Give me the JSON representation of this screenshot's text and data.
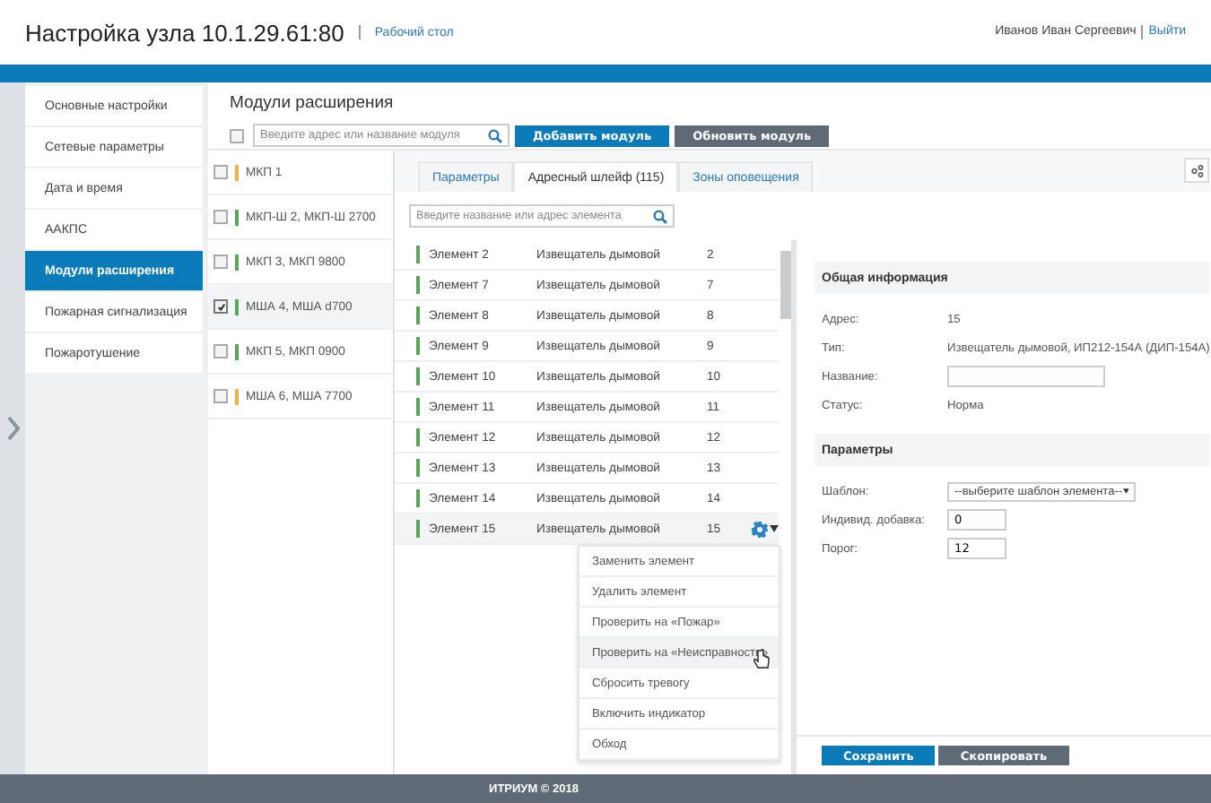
{
  "header": {
    "title": "Настройка узла 10.1.29.61:80",
    "link": "Рабочий стол",
    "user": "Иванов Иван Сергеевич",
    "logout": "Выйти"
  },
  "nav": [
    {
      "label": "Основные настройки",
      "selected": false
    },
    {
      "label": "Сетевые параметры",
      "selected": false
    },
    {
      "label": "Дата и время",
      "selected": false
    },
    {
      "label": "ААКПС",
      "selected": false
    },
    {
      "label": "Модули расширения",
      "selected": true
    },
    {
      "label": "Пожарная сигнализация",
      "selected": false
    },
    {
      "label": "Пожаротушение",
      "selected": false
    }
  ],
  "page_title": "Модули расширения",
  "toolbar": {
    "checked": false,
    "placeholder": "Введите адрес или название модуля",
    "buttons": [
      {
        "label": "Добавить модуль",
        "kind": "primary"
      },
      {
        "label": "Обновить модуль",
        "kind": "secondary"
      }
    ]
  },
  "modules": [
    {
      "label": "МКП 1",
      "color": "#f0b050",
      "checked": false,
      "selected": false
    },
    {
      "label": "МКП-Ш 2, МКП-Ш 2700",
      "color": "#5aa55a",
      "checked": false,
      "selected": false
    },
    {
      "label": "МКП 3, МКП 9800",
      "color": "#5aa55a",
      "checked": false,
      "selected": false
    },
    {
      "label": "МША 4, МША d700",
      "color": "#5aa55a",
      "checked": true,
      "selected": true
    },
    {
      "label": "МКП 5, МКП 0900",
      "color": "#5aa55a",
      "checked": false,
      "selected": false
    },
    {
      "label": "МША 6, МША 7700",
      "color": "#f0b050",
      "checked": false,
      "selected": false
    }
  ],
  "tabs": [
    {
      "label": "Параметры",
      "selected": false
    },
    {
      "label": "Адресный шлейф (115)",
      "selected": true
    },
    {
      "label": "Зоны оповещения",
      "selected": false
    }
  ],
  "element_search": {
    "placeholder": "Введите название или адрес элемента"
  },
  "elements": [
    {
      "name": "Элемент 2",
      "type": "Извещатель дымовой",
      "address": "2",
      "selected": false
    },
    {
      "name": "Элемент 7",
      "type": "Извещатель дымовой",
      "address": "7",
      "selected": false
    },
    {
      "name": "Элемент 8",
      "type": "Извещатель дымовой",
      "address": "8",
      "selected": false
    },
    {
      "name": "Элемент 9",
      "type": "Извещатель дымовой",
      "address": "9",
      "selected": false
    },
    {
      "name": "Элемент 10",
      "type": "Извещатель дымовой",
      "address": "10",
      "selected": false
    },
    {
      "name": "Элемент 11",
      "type": "Извещатель дымовой",
      "address": "11",
      "selected": false
    },
    {
      "name": "Элемент 12",
      "type": "Извещатель дымовой",
      "address": "12",
      "selected": false
    },
    {
      "name": "Элемент 13",
      "type": "Извещатель дымовой",
      "address": "13",
      "selected": false
    },
    {
      "name": "Элемент 14",
      "type": "Извещатель дымовой",
      "address": "14",
      "selected": false
    },
    {
      "name": "Элемент 15",
      "type": "Извещатель дымовой",
      "address": "15",
      "selected": true
    }
  ],
  "context_menu": [
    {
      "label": "Заменить элемент",
      "hovered": false
    },
    {
      "label": "Удалить элемент",
      "hovered": false
    },
    {
      "label": "Проверить на «Пожар»",
      "hovered": false
    },
    {
      "label": "Проверить на «Неисправность»",
      "hovered": true
    },
    {
      "label": "Сбросить тревогу",
      "hovered": false
    },
    {
      "label": "Включить индикатор",
      "hovered": false
    },
    {
      "label": "Обход",
      "hovered": false
    }
  ],
  "details": [
    {
      "title": "Общая информация",
      "rows": [
        {
          "label": "Адрес:",
          "kind": "text",
          "value": "15"
        },
        {
          "label": "Тип:",
          "kind": "text",
          "value": "Извещатель дымовой, ИП212-154А (ДИП-154А)"
        },
        {
          "label": "Название:",
          "kind": "input"
        },
        {
          "label": "Статус:",
          "kind": "text",
          "value": "Норма"
        }
      ]
    },
    {
      "title": "Параметры",
      "rows": [
        {
          "label": "Шаблон:",
          "kind": "select",
          "value": "--выберите шаблон элемента--"
        },
        {
          "label": "Индивид. добавка:",
          "kind": "input",
          "value": "0"
        },
        {
          "label": "Порог:",
          "kind": "input",
          "value": "12"
        }
      ]
    }
  ],
  "actions": [
    {
      "label": "Сохранить",
      "kind": "primary"
    },
    {
      "label": "Скопировать",
      "kind": "secondary"
    }
  ],
  "footer": "ИТРИУМ © 2018"
}
